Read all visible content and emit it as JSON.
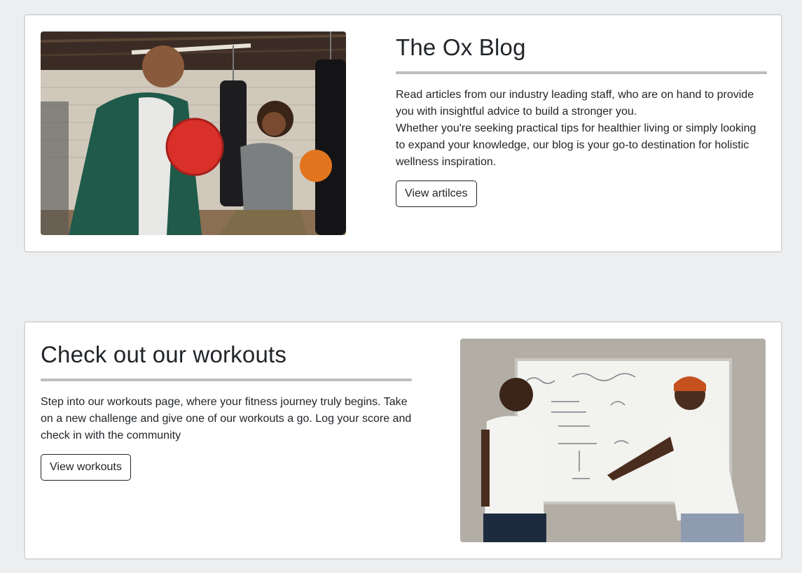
{
  "blog": {
    "title": "The Ox Blog",
    "paragraph_1": "Read articles from our industry leading staff, who are on hand to provide you with insightful advice to build a stronger you.",
    "paragraph_2": "Whether you're seeking practical tips for healthier living or simply looking to expand your knowledge, our blog is your go-to destination for holistic wellness inspiration.",
    "button_label": "View artilces"
  },
  "workouts": {
    "title": "Check out our workouts",
    "paragraph": "Step into our workouts page, where your fitness journey truly begins. Take on a new challenge and give one of our workouts a go. Log your score and check in with the community",
    "button_label": "View workouts"
  },
  "colors": {
    "page_background": "#eceeef",
    "card_border": "#d6d8da",
    "rule": "#bdbec0",
    "text": "#212529"
  }
}
